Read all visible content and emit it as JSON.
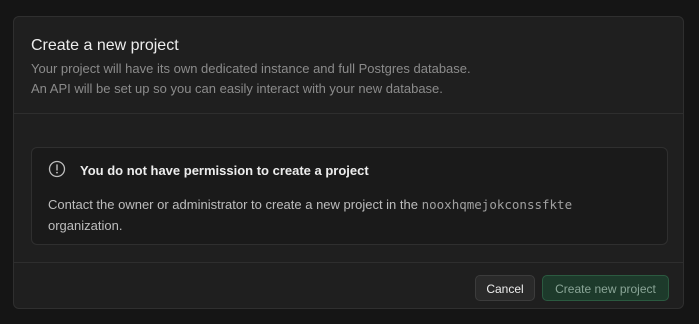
{
  "dialog": {
    "title": "Create a new project",
    "description_line1": "Your project will have its own dedicated instance and full Postgres database.",
    "description_line2": "An API will be set up so you can easily interact with your new database."
  },
  "alert": {
    "icon": "exclamation-circle-icon",
    "title": "You do not have permission to create a project",
    "body_prefix": "Contact the owner or administrator to create a new project in the",
    "organization_slug": "nooxhqmejokconssfkte",
    "body_suffix": "organization."
  },
  "footer": {
    "cancel_label": "Cancel",
    "create_label": "Create new project",
    "create_disabled": true
  },
  "colors": {
    "background": "#151515",
    "dialog": "#1f1f1f",
    "brand_disabled": "#1d3a2b"
  }
}
